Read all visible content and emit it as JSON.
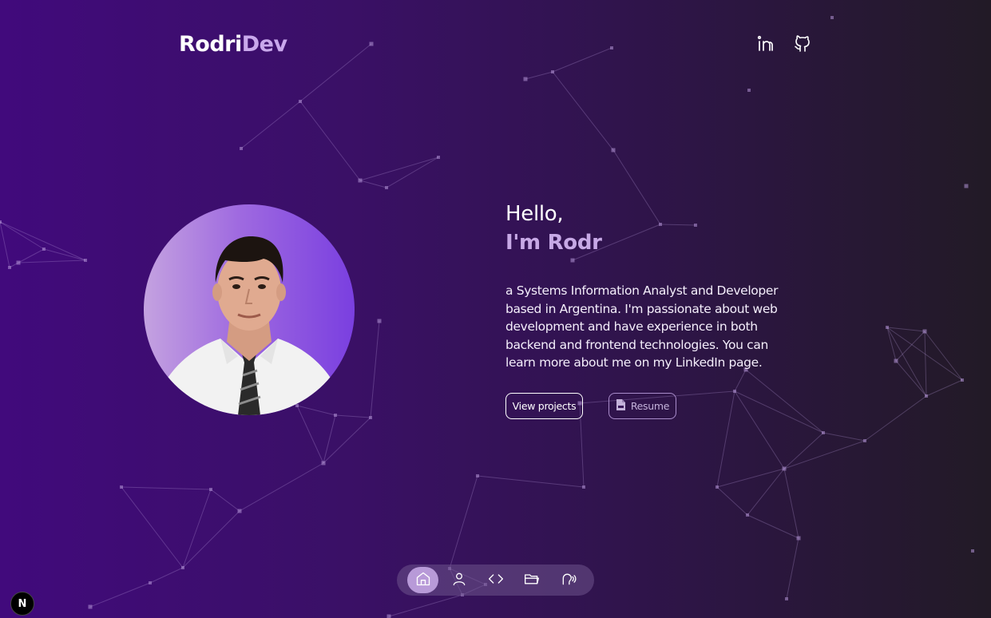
{
  "header": {
    "logo_part1": "Rodri",
    "logo_part2": "Dev",
    "social": [
      "linkedin-icon",
      "github-icon"
    ]
  },
  "hero": {
    "greeting": "Hello,",
    "name": "I'm Rodr",
    "bio": "a Systems Information Analyst and Developer based in Argentina. I'm passionate about web development and have experience in both backend and frontend technologies. You can learn more about me on my LinkedIn page.",
    "primary_button": "View projects",
    "secondary_button": "Resume"
  },
  "dock": {
    "items": [
      "home-icon",
      "user-icon",
      "code-icon",
      "folder-icon",
      "contact-icon"
    ],
    "active": "home-icon"
  },
  "dev_badge": "N",
  "colors": {
    "accent": "#c7a9e6",
    "dock_active": "#b89ad8",
    "bg_start": "#410a7c",
    "bg_end": "#221a26"
  }
}
